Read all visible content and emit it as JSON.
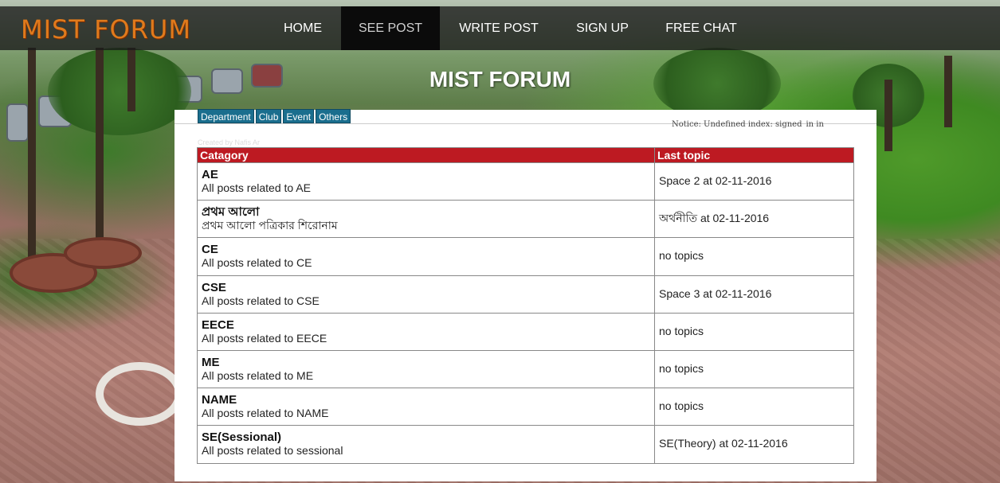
{
  "header": {
    "brand": "MIST FORUM",
    "nav": [
      {
        "label": "HOME",
        "active": false
      },
      {
        "label": "SEE POST",
        "active": true
      },
      {
        "label": "WRITE POST",
        "active": false
      },
      {
        "label": "SIGN UP",
        "active": false
      },
      {
        "label": "FREE CHAT",
        "active": false
      }
    ]
  },
  "hero": {
    "title": "MIST FORUM"
  },
  "category_tabs": [
    "Department",
    "Club",
    "Event",
    "Others"
  ],
  "notice": "Notice: Undefined index: signed_in in",
  "faint_text": "Created by Nafis Ar",
  "table": {
    "headers": {
      "category": "Catagory",
      "last_topic": "Last topic"
    },
    "rows": [
      {
        "name": "AE",
        "description": "All posts related to AE",
        "last_topic": "Space 2 at 02-11-2016"
      },
      {
        "name": "প্রথম আলো",
        "description": "প্রথম আলো পত্রিকার শিরোনাম",
        "last_topic": "অর্থনীতি at 02-11-2016"
      },
      {
        "name": "CE",
        "description": "All posts related to CE",
        "last_topic": "no topics"
      },
      {
        "name": "CSE",
        "description": "All posts related to CSE",
        "last_topic": "Space 3 at 02-11-2016"
      },
      {
        "name": "EECE",
        "description": "All posts related to EECE",
        "last_topic": "no topics"
      },
      {
        "name": "ME",
        "description": "All posts related to ME",
        "last_topic": "no topics"
      },
      {
        "name": "NAME",
        "description": "All posts related to NAME",
        "last_topic": "no topics"
      },
      {
        "name": "SE(Sessional)",
        "description": "All posts related to sessional",
        "last_topic": "SE(Theory) at 02-11-2016"
      }
    ]
  },
  "colors": {
    "navbar_bg": "#191919",
    "brand": "#e07a1c",
    "table_header": "#bd1a22",
    "tab_bg": "#1a6e8e"
  }
}
